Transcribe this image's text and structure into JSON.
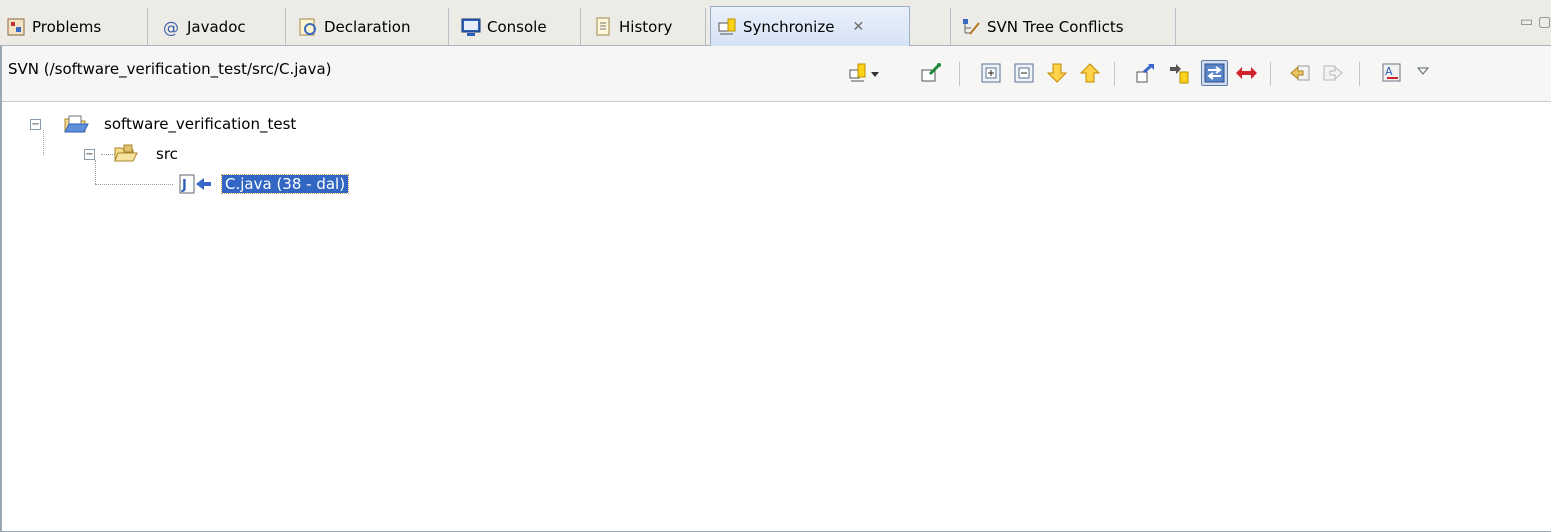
{
  "tabs": [
    {
      "label": "Problems",
      "icon": "problems-icon",
      "active": false
    },
    {
      "label": "Javadoc",
      "icon": "at-sign-icon",
      "active": false
    },
    {
      "label": "Declaration",
      "icon": "declaration-icon",
      "active": false
    },
    {
      "label": "Console",
      "icon": "console-icon",
      "active": false
    },
    {
      "label": "History",
      "icon": "history-icon",
      "active": false
    },
    {
      "label": "Synchronize",
      "icon": "synchronize-icon",
      "active": true,
      "close": "✕"
    },
    {
      "label": "SVN Tree Conflicts",
      "icon": "tree-conflicts-icon",
      "active": false
    }
  ],
  "window_controls": {
    "minimize": "▭",
    "maximize": "▢"
  },
  "panel": {
    "title": "SVN (/software_verification_test/src/C.java)"
  },
  "toolbar_icons": [
    "synchronize-dropdown-icon",
    "pin-icon",
    "expand-all-icon",
    "collapse-all-icon",
    "next-difference-icon",
    "previous-difference-icon",
    "incoming-mode-icon",
    "outgoing-mode-icon",
    "incoming-outgoing-mode-icon",
    "conflicts-mode-icon",
    "back-icon",
    "forward-icon",
    "presentation-icon",
    "view-menu-icon"
  ],
  "tree": {
    "project": {
      "label": "software_verification_test",
      "toggle": "−"
    },
    "folder": {
      "label": "src",
      "toggle": "−"
    },
    "file": {
      "label": "C.java (38 - dal)"
    }
  },
  "colors": {
    "selection": "#3166c4",
    "active_tab": "#d6e3f5",
    "incoming_arrow": "#3b66c9",
    "conflict_red": "#d0242b"
  }
}
